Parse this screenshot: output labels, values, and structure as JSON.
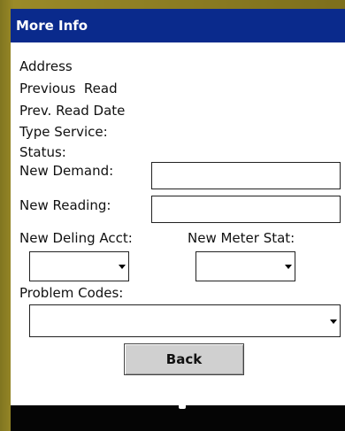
{
  "window": {
    "title": "More Info"
  },
  "fields": {
    "address_label": "Address",
    "previous_read_label": "Previous  Read",
    "prev_read_date_label": "Prev. Read Date",
    "type_service_label": "Type Service:",
    "status_label": "Status:",
    "new_demand_label": "New Demand:",
    "new_demand_value": "",
    "new_reading_label": "New Reading:",
    "new_reading_value": "",
    "new_deling_acct_label": "New Deling Acct:",
    "new_deling_acct_value": "",
    "new_meter_stat_label": "New Meter Stat:",
    "new_meter_stat_value": "",
    "problem_codes_label": "Problem Codes:",
    "problem_codes_value": ""
  },
  "buttons": {
    "back_label": "Back"
  },
  "icons": {
    "dropdown": "chevron-down-icon",
    "handle": "resize-handle-icon"
  },
  "colors": {
    "titlebar": "#0a2a8c",
    "frame": "#7c6f1e",
    "bottombar": "#050505",
    "button": "#d0d0d0"
  }
}
